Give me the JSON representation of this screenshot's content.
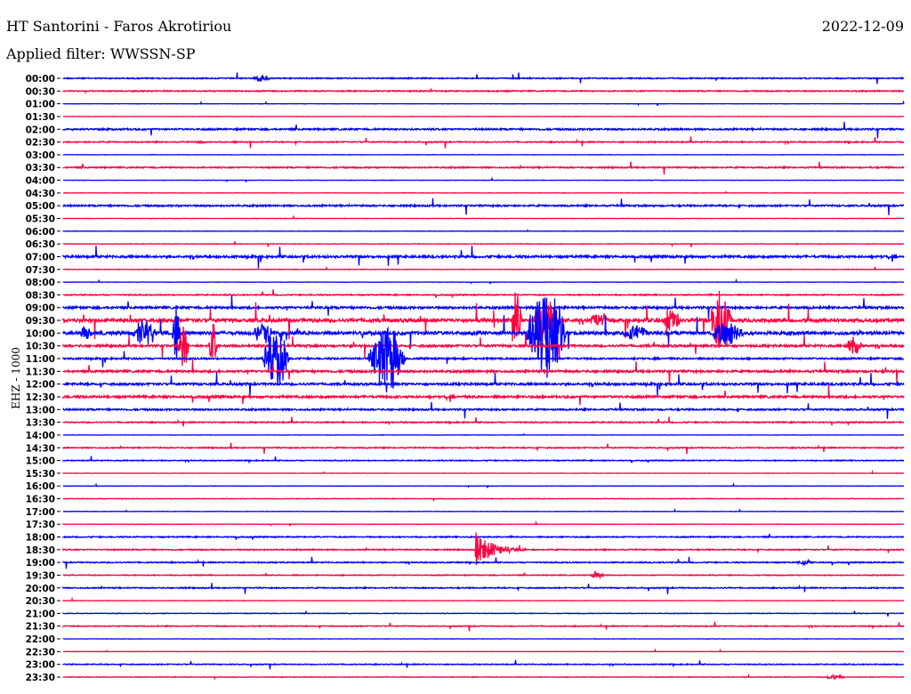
{
  "header": {
    "station": "HT Santorini - Faros Akrotiriou",
    "filter": "Applied filter: WWSSN-SP",
    "date": "2022-12-09"
  },
  "chart_data": {
    "type": "line",
    "title": "HT Santorini - Faros Akrotiriou",
    "ylabel": "EHZ - 1000",
    "row_minutes": 30,
    "colors": [
      "#0000ff",
      "#ff0040"
    ],
    "row_labels": [
      "00:00",
      "00:30",
      "01:00",
      "01:30",
      "02:00",
      "02:30",
      "03:00",
      "03:30",
      "04:00",
      "04:30",
      "05:00",
      "05:30",
      "06:00",
      "06:30",
      "07:00",
      "07:30",
      "08:00",
      "08:30",
      "09:00",
      "09:30",
      "10:00",
      "10:30",
      "11:00",
      "11:30",
      "12:00",
      "12:30",
      "13:00",
      "13:30",
      "14:00",
      "14:30",
      "15:00",
      "15:30",
      "16:00",
      "16:30",
      "17:00",
      "17:30",
      "18:00",
      "18:30",
      "19:00",
      "19:30",
      "20:00",
      "20:30",
      "21:00",
      "21:30",
      "22:00",
      "22:30",
      "23:00",
      "23:30"
    ],
    "noise_level": [
      1,
      1,
      0.3,
      0.3,
      1.5,
      1,
      0.3,
      1.2,
      0.3,
      0.3,
      1.5,
      0.3,
      0.3,
      0.5,
      2,
      0.5,
      0.3,
      1,
      2,
      3,
      3,
      2,
      1.5,
      2,
      2,
      2,
      1.5,
      1,
      0.3,
      1,
      0.8,
      0.3,
      0.3,
      0.5,
      0.3,
      0.3,
      1,
      1,
      1,
      0.8,
      1,
      0.3,
      0.5,
      0.8,
      0.3,
      0.3,
      0.8,
      0.5
    ],
    "events": [
      {
        "row": "00:00",
        "start_min": 6.8,
        "end_min": 7.6,
        "amplitude": 5
      },
      {
        "row": "02:30",
        "start_min": 4.7,
        "end_min": 5.2,
        "amplitude": 2
      },
      {
        "row": "09:30",
        "start_min": 16.0,
        "end_min": 16.5,
        "amplitude": 40
      },
      {
        "row": "09:30",
        "start_min": 16.8,
        "end_min": 18.0,
        "amplitude": 30
      },
      {
        "row": "09:30",
        "start_min": 18.8,
        "end_min": 19.6,
        "amplitude": 15
      },
      {
        "row": "09:30",
        "start_min": 21.4,
        "end_min": 22.2,
        "amplitude": 18
      },
      {
        "row": "09:30",
        "start_min": 23.1,
        "end_min": 24.1,
        "amplitude": 45
      },
      {
        "row": "10:00",
        "start_min": 0.6,
        "end_min": 1.2,
        "amplitude": 10
      },
      {
        "row": "10:00",
        "start_min": 2.5,
        "end_min": 3.6,
        "amplitude": 20
      },
      {
        "row": "10:00",
        "start_min": 3.9,
        "end_min": 4.3,
        "amplitude": 50
      },
      {
        "row": "10:00",
        "start_min": 6.8,
        "end_min": 7.8,
        "amplitude": 15
      },
      {
        "row": "10:00",
        "start_min": 16.5,
        "end_min": 18.4,
        "amplitude": 60
      },
      {
        "row": "10:00",
        "start_min": 20.0,
        "end_min": 21.2,
        "amplitude": 10
      },
      {
        "row": "10:00",
        "start_min": 23.1,
        "end_min": 24.7,
        "amplitude": 15
      },
      {
        "row": "10:30",
        "start_min": 4.1,
        "end_min": 4.6,
        "amplitude": 30
      },
      {
        "row": "10:30",
        "start_min": 5.2,
        "end_min": 5.6,
        "amplitude": 30
      },
      {
        "row": "10:30",
        "start_min": 27.9,
        "end_min": 28.7,
        "amplitude": 12
      },
      {
        "row": "11:00",
        "start_min": 7.1,
        "end_min": 8.4,
        "amplitude": 35
      },
      {
        "row": "11:00",
        "start_min": 10.9,
        "end_min": 12.6,
        "amplitude": 45
      },
      {
        "row": "18:30",
        "start_min": 14.7,
        "end_min": 16.5,
        "amplitude": 20,
        "decay": true
      },
      {
        "row": "19:00",
        "start_min": 26.2,
        "end_min": 26.9,
        "amplitude": 3
      },
      {
        "row": "19:30",
        "start_min": 18.8,
        "end_min": 19.5,
        "amplitude": 4
      },
      {
        "row": "23:30",
        "start_min": 27.2,
        "end_min": 28.1,
        "amplitude": 3
      }
    ]
  }
}
